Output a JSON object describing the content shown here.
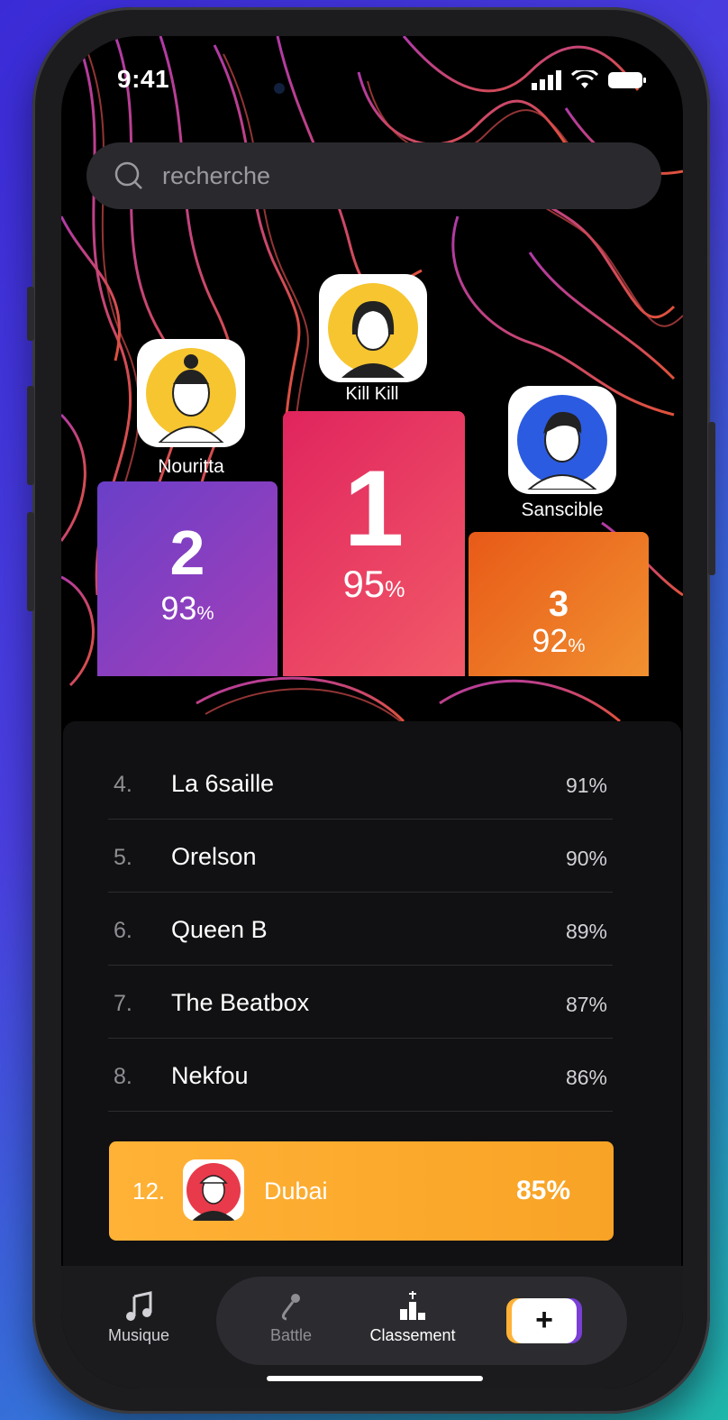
{
  "status": {
    "time": "9:41"
  },
  "search": {
    "placeholder": "recherche"
  },
  "podium": [
    {
      "position": "first",
      "rank": "1",
      "name": "Kill Kill",
      "percent": "95",
      "color": "#e0245e"
    },
    {
      "position": "second",
      "rank": "2",
      "name": "Nouritta",
      "percent": "93",
      "color": "#8b3fc7"
    },
    {
      "position": "third",
      "rank": "3",
      "name": "Sanscible",
      "percent": "92",
      "color": "#f07b1e"
    }
  ],
  "percent_sign": "%",
  "leaderboard": [
    {
      "rank": "4.",
      "name": "La 6saille",
      "score": "91%"
    },
    {
      "rank": "5.",
      "name": "Orelson",
      "score": "90%"
    },
    {
      "rank": "6.",
      "name": "Queen B",
      "score": "89%"
    },
    {
      "rank": "7.",
      "name": "The Beatbox",
      "score": "87%"
    },
    {
      "rank": "8.",
      "name": "Nekfou",
      "score": "86%"
    }
  ],
  "more_indicator": "•••",
  "current_user": {
    "rank": "12.",
    "name": "Dubai",
    "score": "85%"
  },
  "tabbar": {
    "items": [
      {
        "label": "Musique",
        "icon": "music-note-icon"
      },
      {
        "label": "Battle",
        "icon": "microphone-icon"
      },
      {
        "label": "Classement",
        "icon": "podium-icon"
      }
    ],
    "add_label": "+"
  },
  "colors": {
    "accent_orange": "#f8a326",
    "pink": "#e0245e",
    "purple": "#8b3fc7"
  }
}
